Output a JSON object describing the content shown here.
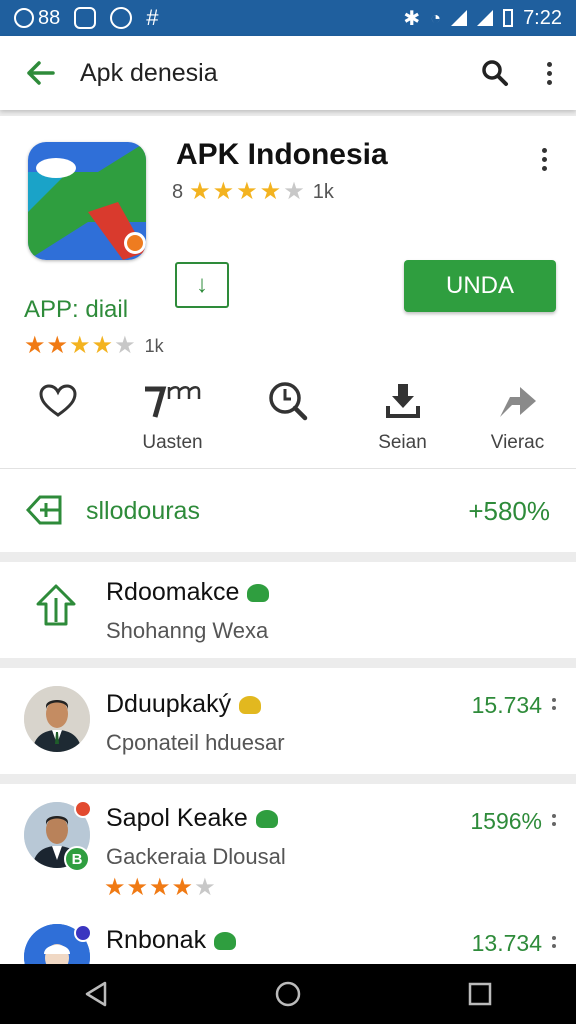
{
  "status_bar": {
    "left_number": "88",
    "time": "7:22"
  },
  "toolbar": {
    "title": "Apk denesia",
    "icons": [
      "back-arrow-icon",
      "search-icon",
      "more-vert-icon"
    ]
  },
  "app": {
    "name": "APK Indonesia",
    "rating_prefix": "8",
    "rating_count": "1k",
    "stars": 4,
    "subtitle": "APP: diail",
    "stars2": 4,
    "rating2_label": "1k",
    "install_label": "UNDA",
    "accent": "#2f9e3f"
  },
  "actions": [
    {
      "icon": "heart-icon",
      "label": ""
    },
    {
      "icon": "font-size-icon",
      "label": "Uasten"
    },
    {
      "icon": "search-clock-icon",
      "label": ""
    },
    {
      "icon": "download-tray-icon",
      "label": "Seian"
    },
    {
      "icon": "share-arrow-icon",
      "label": "Vierac"
    }
  ],
  "stat": {
    "label": "sllodouras",
    "value": "+580%"
  },
  "rows": [
    {
      "title": "Rdoomakce",
      "subtitle": "Shohanng Wexa",
      "value": ""
    },
    {
      "title": "Dduupkaký",
      "subtitle": "Cponateil hduesar",
      "value": "15.734"
    },
    {
      "title": "Sapol Keake",
      "subtitle": "Gackeraia Dlousal",
      "value": "1596%",
      "stars": 4
    },
    {
      "title": "Rnbonak",
      "subtitle": "",
      "value": "13.734"
    }
  ]
}
